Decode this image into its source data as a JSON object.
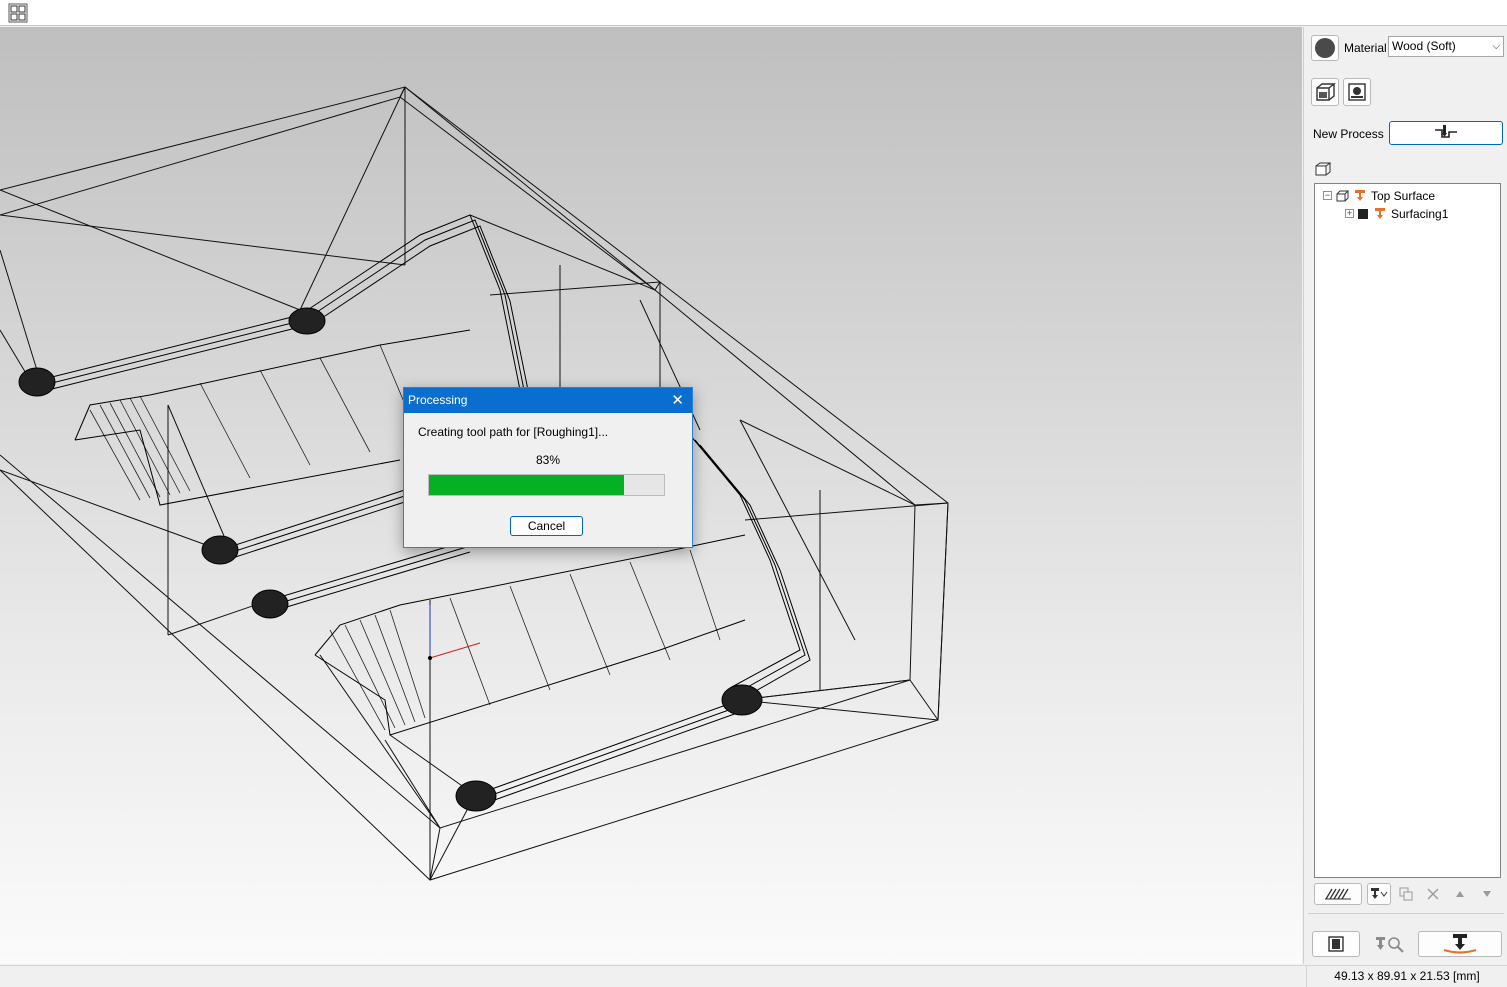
{
  "toolbar": {
    "view_grid_icon": "grid-view-icon"
  },
  "panel": {
    "material_label": "Material",
    "material_value": "Wood (Soft)",
    "new_process_label": "New Process",
    "tree": [
      {
        "label": "Top Surface",
        "expander": "−"
      },
      {
        "label": "Surfacing1",
        "expander": "+"
      }
    ]
  },
  "dialog": {
    "title": "Processing",
    "message": "Creating tool path for [Roughing1]...",
    "percent_label": "83%",
    "progress": 0.83,
    "cancel_label": "Cancel"
  },
  "status": {
    "dimensions": "49.13 x 89.91 x 21.53 [mm]"
  },
  "colors": {
    "accent": "#0067c0",
    "title_bar": "#0a6ecf",
    "progress": "#06b025",
    "tool_orange": "#e8702a"
  }
}
